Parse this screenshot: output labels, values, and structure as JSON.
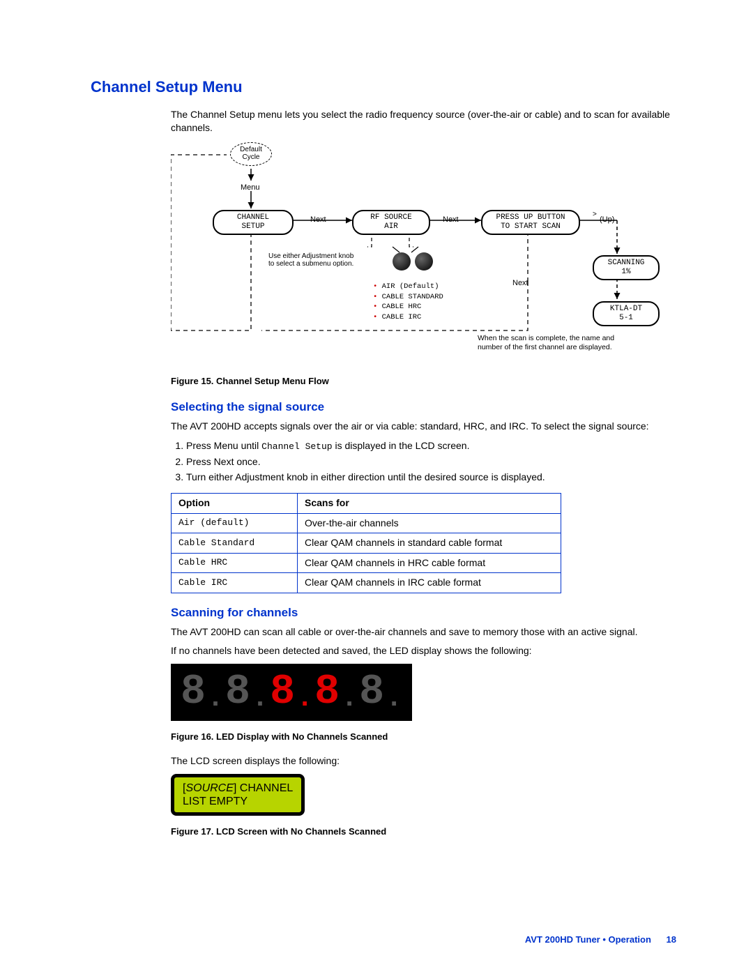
{
  "title": "Channel Setup Menu",
  "intro": "The Channel Setup menu lets you select the radio frequency source (over-the-air or cable) and to scan for available channels.",
  "figure15_caption": "Figure 15. Channel Setup Menu Flow",
  "diagram": {
    "cycle_top": "Default",
    "cycle_bottom": "Cycle",
    "menu_label": "Menu",
    "channel_setup_l1": "CHANNEL",
    "channel_setup_l2": "SETUP",
    "next1": "Next",
    "rf_source_l1": "RF SOURCE",
    "rf_source_l2": "AIR",
    "next2": "Next",
    "press_up_l1": "PRESS UP BUTTON",
    "press_up_l2": "TO START SCAN",
    "up_label": "(Up)",
    "scanning_l1": "SCANNING",
    "scanning_l2": "1%",
    "ktla_l1": "KTLA-DT",
    "ktla_l2": "5-1",
    "next3": "Next",
    "knob_note_l1": "Use either Adjustment knob",
    "knob_note_l2": "to select a submenu option.",
    "bullets": {
      "b1": "AIR (Default)",
      "b2": "CABLE STANDARD",
      "b3": "CABLE HRC",
      "b4": "CABLE IRC"
    },
    "scan_note_l1": "When the scan is complete, the name and",
    "scan_note_l2": "number of the first channel are displayed."
  },
  "selecting": {
    "heading": "Selecting the signal source",
    "para": "The AVT 200HD accepts signals over the air or via cable: standard, HRC, and IRC. To select the signal source:",
    "step1_a": "Press Menu until ",
    "step1_code": "Channel Setup",
    "step1_b": " is displayed in the LCD screen.",
    "step2": "Press Next once.",
    "step3": "Turn either Adjustment knob in either direction until the desired source is displayed."
  },
  "table": {
    "h1": "Option",
    "h2": "Scans for",
    "rows": [
      {
        "opt": "Air (default)",
        "scan": "Over-the-air channels"
      },
      {
        "opt": "Cable Standard",
        "scan": "Clear QAM channels in standard cable format"
      },
      {
        "opt": "Cable HRC",
        "scan": "Clear QAM channels in HRC cable format"
      },
      {
        "opt": "Cable IRC",
        "scan": "Clear QAM channels in IRC cable format"
      }
    ]
  },
  "scanning": {
    "heading": "Scanning for channels",
    "para1": "The AVT 200HD can scan all cable or over-the-air channels and save to memory those with an active signal.",
    "para2": "If no channels have been detected and saved, the LED display shows the following:"
  },
  "figure16_caption": "Figure 16. LED Display with No Channels Scanned",
  "lcd_intro": "The LCD screen displays the following:",
  "lcd": {
    "source_label": "SOURCE",
    "line1_rest": " CHANNEL",
    "line2": "LIST EMPTY"
  },
  "figure17_caption": "Figure 17. LCD Screen with No Channels Scanned",
  "footer": {
    "text": "AVT 200HD Tuner • Operation",
    "page": "18"
  },
  "led_glyphs": {
    "off": "8",
    "dot": "."
  }
}
